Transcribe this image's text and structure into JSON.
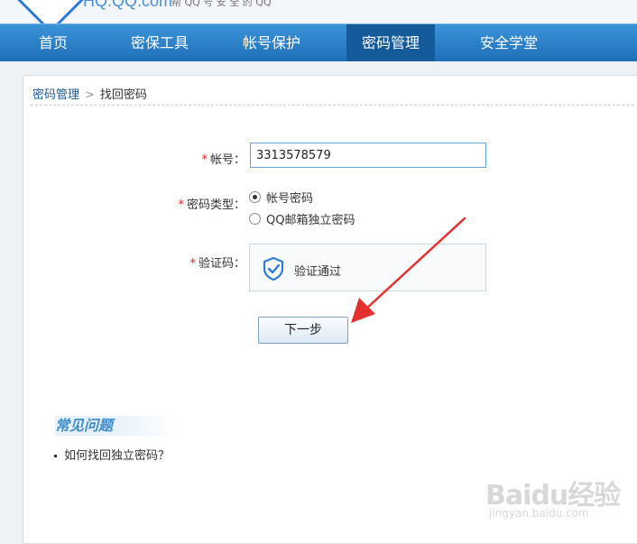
{
  "header": {
    "logo_text": "HQ.QQ.com",
    "slogan": "帮 QQ 号 安 全 的 QQ"
  },
  "nav": {
    "items": [
      {
        "label": "首页"
      },
      {
        "label": "密保工具"
      },
      {
        "label": "帐号保护"
      },
      {
        "label": "密码管理",
        "active": true
      },
      {
        "label": "安全学堂"
      }
    ]
  },
  "breadcrumb": {
    "parent": "密码管理",
    "separator": ">",
    "current": "找回密码"
  },
  "form": {
    "required_mark": "*",
    "account_label": "帐号：",
    "account_value": "3313578579",
    "pwtype_label": "密码类型：",
    "pwtype_options": [
      {
        "label": "帐号密码",
        "selected": true
      },
      {
        "label": "QQ邮箱独立密码",
        "selected": false
      }
    ],
    "captcha_label": "验证码：",
    "captcha_status": "验证通过",
    "next_button": "下一步"
  },
  "faq": {
    "title": "常见问题",
    "items": [
      "如何找回独立密码？"
    ]
  },
  "watermark": {
    "brand": "Baidu经验",
    "url": "jingyan.baidu.com"
  },
  "colors": {
    "nav_bg": "#2a80c8",
    "nav_active": "#155a99",
    "link": "#1a5a9a",
    "required": "#dd2222",
    "arrow": "#e53030",
    "shield": "#2f7bd8"
  },
  "icons": [
    "shield-check-icon",
    "red-arrow-annotation"
  ]
}
